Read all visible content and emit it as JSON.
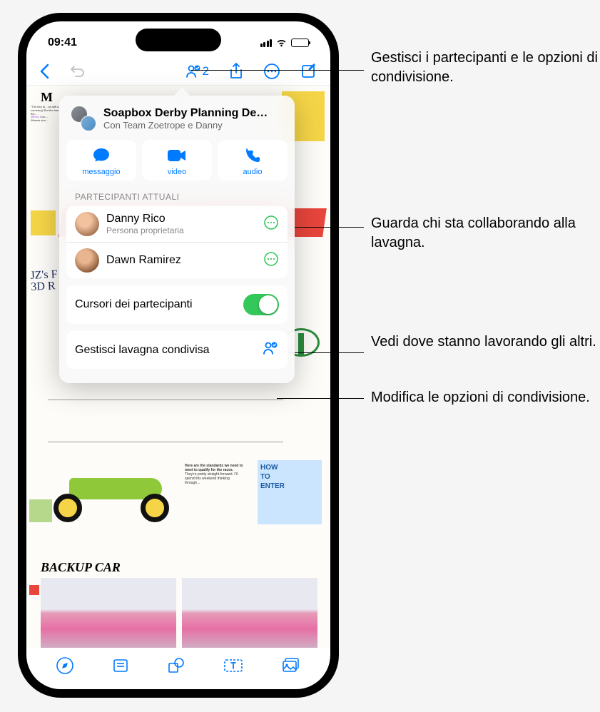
{
  "status_bar": {
    "time": "09:41"
  },
  "toolbar": {
    "participant_count": "2"
  },
  "popover": {
    "title": "Soapbox Derby Planning De…",
    "subtitle": "Con Team Zoetrope e Danny",
    "actions": {
      "message": "messaggio",
      "video": "video",
      "audio": "audio"
    },
    "section_label": "PARTECIPANTI ATTUALI",
    "participants": [
      {
        "name": "Danny Rico",
        "role": "Persona proprietaria"
      },
      {
        "name": "Dawn Ramirez",
        "role": ""
      }
    ],
    "cursors_toggle_label": "Cursori dei partecipanti",
    "cursors_toggle_on": true,
    "manage_label": "Gestisci lavagna condivisa"
  },
  "canvas": {
    "heading1": "M",
    "heading2": "JZ's F\n3D R",
    "backup_label": "BACKUP CAR",
    "howto_label": "HOW\nTO\nENTER"
  },
  "callouts": {
    "c1": "Gestisci i partecipanti e le opzioni di condivisione.",
    "c2": "Guarda chi sta collaborando alla lavagna.",
    "c3": "Vedi dove stanno lavorando gli altri.",
    "c4": "Modifica le opzioni di condivisione."
  }
}
